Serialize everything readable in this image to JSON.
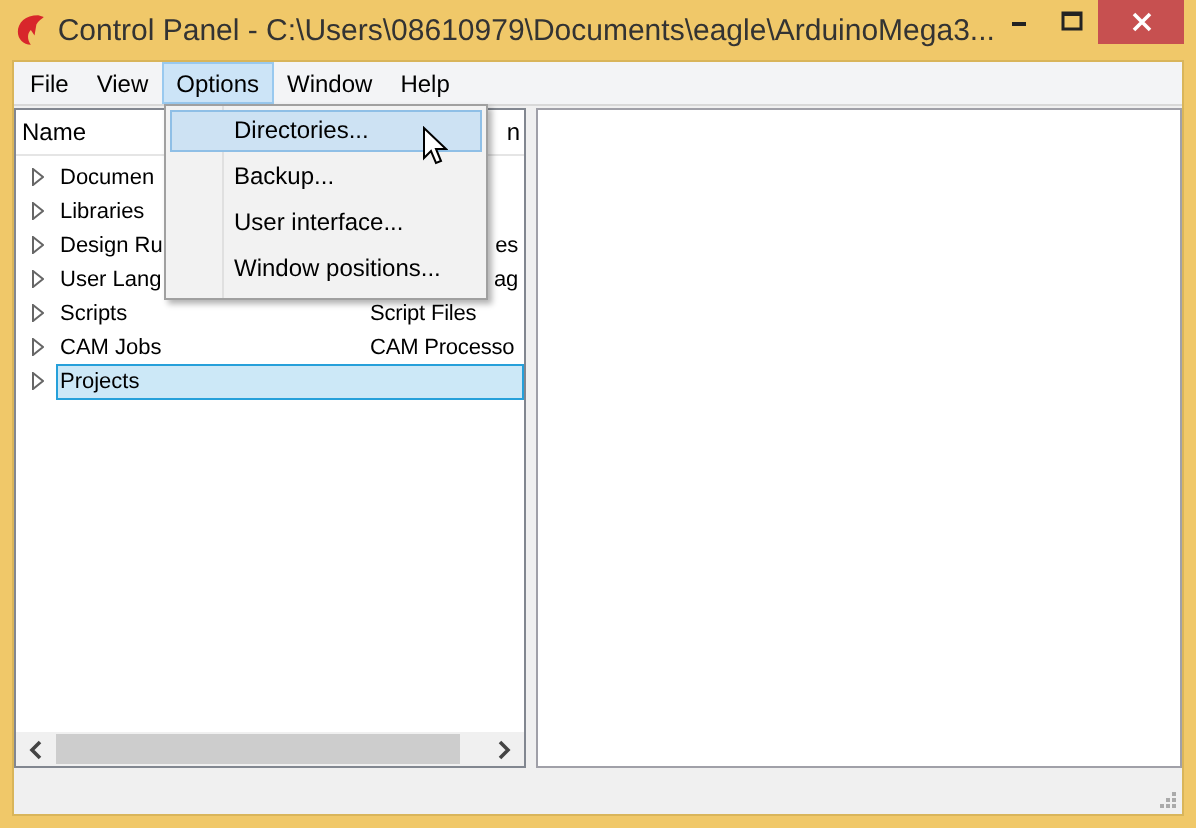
{
  "window": {
    "title": "Control Panel - C:\\Users\\08610979\\Documents\\eagle\\ArduinoMega3..."
  },
  "menu_bar": [
    {
      "label": "File",
      "selected": false
    },
    {
      "label": "View",
      "selected": false
    },
    {
      "label": "Options",
      "selected": true
    },
    {
      "label": "Window",
      "selected": false
    },
    {
      "label": "Help",
      "selected": false
    }
  ],
  "tree": {
    "columns": [
      {
        "label": "Name",
        "clipped": false
      },
      {
        "label": "n",
        "clipped": true
      }
    ],
    "rows": [
      {
        "name": "Documen",
        "selected": false
      },
      {
        "name": "Libraries",
        "selected": false
      },
      {
        "name": "Design Ru",
        "description": "es",
        "clipped": true,
        "selected": false
      },
      {
        "name": "User Lang",
        "description": "ag",
        "clipped": true,
        "selected": false
      },
      {
        "name": "Scripts",
        "description": "Script Files",
        "clipped": false,
        "selected": false
      },
      {
        "name": "CAM Jobs",
        "description": "CAM Processo",
        "clipped": false,
        "selected": false
      },
      {
        "name": "Projects",
        "selected": true
      }
    ]
  },
  "dropdown": [
    {
      "label": "Directories...",
      "selected": true
    },
    {
      "label": "Backup...",
      "selected": false
    },
    {
      "label": "User interface...",
      "selected": false
    },
    {
      "label": "Window positions...",
      "selected": false
    }
  ]
}
